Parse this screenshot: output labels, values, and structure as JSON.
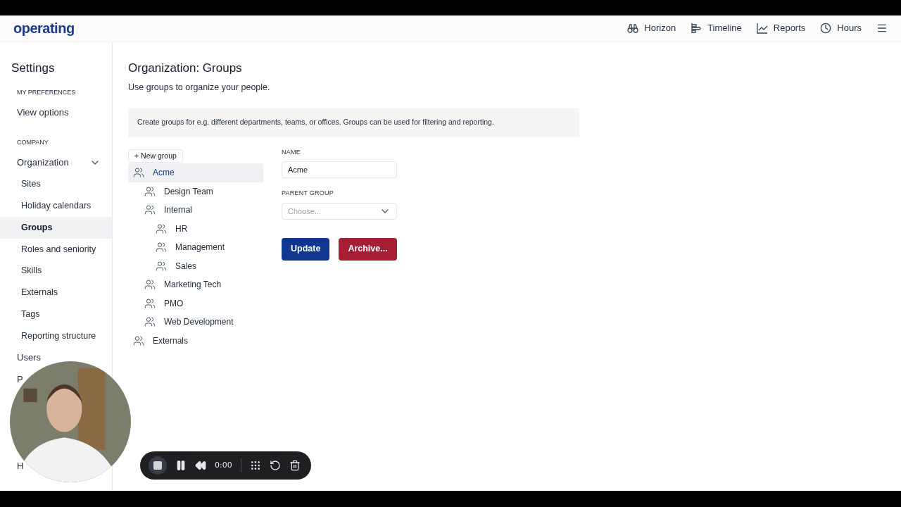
{
  "header": {
    "logo": "operating",
    "nav": [
      {
        "label": "Horizon"
      },
      {
        "label": "Timeline"
      },
      {
        "label": "Reports"
      },
      {
        "label": "Hours"
      }
    ]
  },
  "sidebar": {
    "title": "Settings",
    "sections": [
      {
        "heading": "MY PREFERENCES",
        "items": [
          {
            "label": "View options",
            "selected": false
          }
        ]
      },
      {
        "heading": "COMPANY",
        "items": [
          {
            "label": "Organization",
            "selected": false,
            "expanded": true,
            "children": [
              {
                "label": "Sites",
                "selected": false
              },
              {
                "label": "Holiday calendars",
                "selected": false
              },
              {
                "label": "Groups",
                "selected": true
              },
              {
                "label": "Roles and seniority",
                "selected": false
              },
              {
                "label": "Skills",
                "selected": false
              },
              {
                "label": "Externals",
                "selected": false
              },
              {
                "label": "Tags",
                "selected": false
              },
              {
                "label": "Reporting structure",
                "selected": false
              }
            ]
          },
          {
            "label": "Users",
            "selected": false
          },
          {
            "label": "P",
            "selected": false
          },
          {
            "label": "H",
            "selected": false
          }
        ]
      }
    ]
  },
  "page": {
    "title": "Organization: Groups",
    "subtitle": "Use groups to organize your people.",
    "info": "Create groups for e.g. different departments, teams, or offices. Groups can be used for filtering and reporting.",
    "new_button": "+ New group",
    "groups": [
      {
        "label": "Acme",
        "selected": true,
        "children": [
          {
            "label": "Design Team",
            "selected": false
          },
          {
            "label": "Internal",
            "selected": false,
            "children": [
              {
                "label": "HR",
                "selected": false
              },
              {
                "label": "Management",
                "selected": false
              },
              {
                "label": "Sales",
                "selected": false
              }
            ]
          },
          {
            "label": "Marketing Tech",
            "selected": false
          },
          {
            "label": "PMO",
            "selected": false
          },
          {
            "label": "Web Development",
            "selected": false
          }
        ]
      },
      {
        "label": "Externals",
        "selected": false
      }
    ],
    "form": {
      "name_label": "NAME",
      "name_value": "Acme",
      "parent_label": "PARENT GROUP",
      "parent_placeholder": "Choose...",
      "buttons": [
        {
          "label": "Update",
          "kind": "primary"
        },
        {
          "label": "Archive...",
          "kind": "danger"
        }
      ]
    }
  },
  "recorder": {
    "time": "0:00"
  }
}
